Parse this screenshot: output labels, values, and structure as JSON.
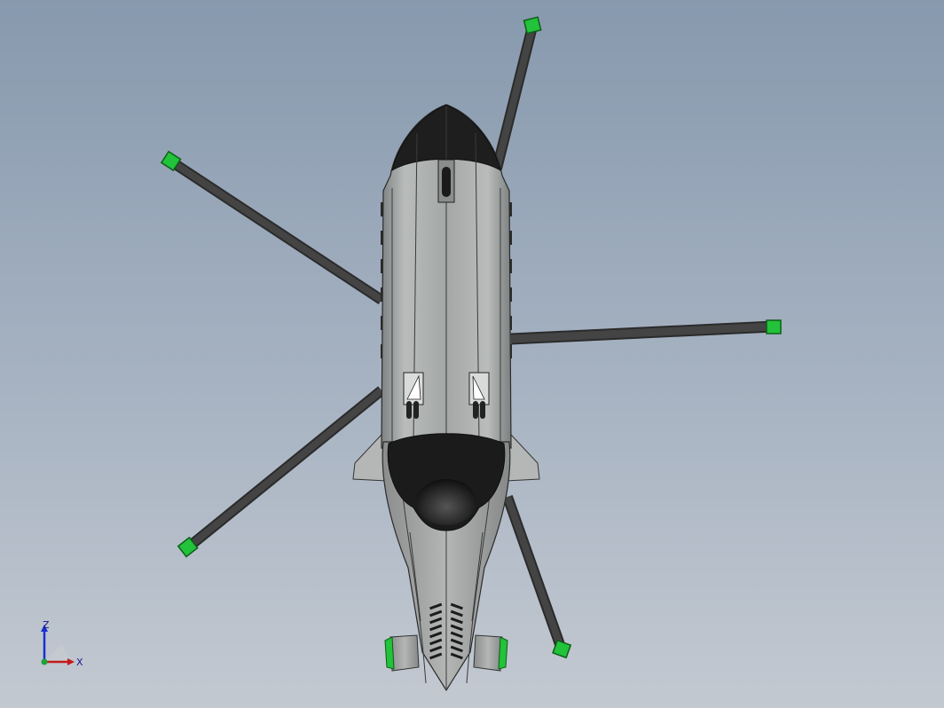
{
  "viewport": {
    "background_top": "#8799ae",
    "background_bottom": "#c3c9d1"
  },
  "model": {
    "name": "helicopter-top-view",
    "body_color": "#a9acab",
    "dark_color": "#1e1e1e",
    "blade_color": "#3a3a3a",
    "blade_tip_color": "#22c23a",
    "rotor_blade_count": 5
  },
  "triad": {
    "z_label": "Z",
    "x_label": "X",
    "z_color": "#1a2fd0",
    "x_color": "#c41a1a",
    "origin_color": "#1aa33a"
  }
}
